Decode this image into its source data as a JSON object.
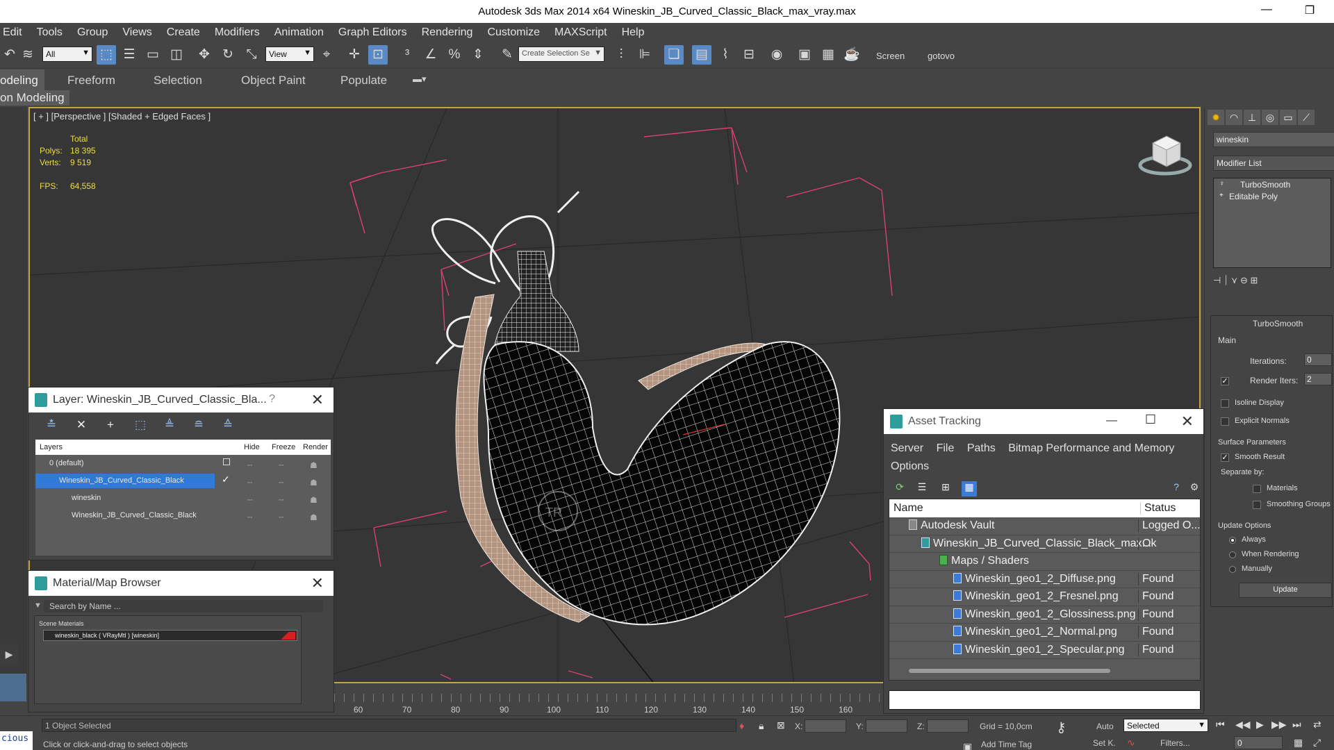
{
  "window": {
    "title": "Autodesk 3ds Max  2014 x64      Wineskin_JB_Curved_Classic_Black_max_vray.max",
    "minimize": "—",
    "restore": "❐"
  },
  "menu": [
    "Edit",
    "Tools",
    "Group",
    "Views",
    "Create",
    "Modifiers",
    "Animation",
    "Graph Editors",
    "Rendering",
    "Customize",
    "MAXScript",
    "Help"
  ],
  "toolbar": {
    "filter_value": "All",
    "refcoord_value": "View",
    "named_selection_placeholder": "Create Selection Se",
    "screen_label": "Screen",
    "gotovo_label": "gotovo"
  },
  "ribbon": {
    "tabs": [
      "odeling",
      "Freeform",
      "Selection",
      "Object Paint",
      "Populate"
    ],
    "sub_label": "on Modeling"
  },
  "viewport": {
    "label": "[ + ] [Perspective ] [Shaded + Edged Faces ]",
    "stats": {
      "total_label": "Total",
      "polys_label": "Polys:",
      "polys_value": "18 395",
      "verts_label": "Verts:",
      "verts_value": "9 519",
      "fps_label": "FPS:",
      "fps_value": "64,558"
    }
  },
  "layer_panel": {
    "title": "Layer: Wineskin_JB_Curved_Classic_Bla...",
    "help": "?",
    "close": "✕",
    "columns": [
      "Layers",
      "Hide",
      "Freeze",
      "Render"
    ],
    "rows": [
      {
        "name": "0 (default)",
        "indent": 0,
        "selected": false
      },
      {
        "name": "Wineskin_JB_Curved_Classic_Black",
        "indent": 0,
        "selected": true
      },
      {
        "name": "wineskin",
        "indent": 1,
        "selected": false
      },
      {
        "name": "Wineskin_JB_Curved_Classic_Black",
        "indent": 1,
        "selected": false
      }
    ]
  },
  "material_browser": {
    "title": "Material/Map Browser",
    "close": "✕",
    "search_placeholder": "Search by Name ...",
    "group": "Scene Materials",
    "item": "wineskin_black  ( VRayMtl ) [wineskin]"
  },
  "asset_tracking": {
    "title": "Asset Tracking",
    "minimize": "—",
    "maximize": "☐",
    "close": "✕",
    "menu_row1": [
      "Server",
      "File",
      "Paths",
      "Bitmap Performance and Memory"
    ],
    "menu_row2": [
      "Options"
    ],
    "columns": [
      "Name",
      "Status"
    ],
    "rows": [
      {
        "name": "Autodesk Vault",
        "status": "Logged O...",
        "indent": 1,
        "icon": "vault"
      },
      {
        "name": "Wineskin_JB_Curved_Classic_Black_max...",
        "status": "Ok",
        "indent": 2,
        "icon": "max"
      },
      {
        "name": "Maps / Shaders",
        "status": "",
        "indent": 3,
        "icon": "maps"
      },
      {
        "name": "Wineskin_geo1_2_Diffuse.png",
        "status": "Found",
        "indent": 4,
        "icon": "file"
      },
      {
        "name": "Wineskin_geo1_2_Fresnel.png",
        "status": "Found",
        "indent": 4,
        "icon": "file"
      },
      {
        "name": "Wineskin_geo1_2_Glossiness.png",
        "status": "Found",
        "indent": 4,
        "icon": "file"
      },
      {
        "name": "Wineskin_geo1_2_Normal.png",
        "status": "Found",
        "indent": 4,
        "icon": "file"
      },
      {
        "name": "Wineskin_geo1_2_Specular.png",
        "status": "Found",
        "indent": 4,
        "icon": "file"
      }
    ]
  },
  "command_panel": {
    "object_name": "wineskin",
    "modifier_list": "Modifier List",
    "stack": [
      "TurboSmooth",
      "Editable Poly"
    ],
    "rollout_title": "TurboSmooth",
    "main_label": "Main",
    "iterations_label": "Iterations:",
    "iterations_value": "0",
    "render_iters_label": "Render Iters:",
    "render_iters_value": "2",
    "isoline_label": "Isoline Display",
    "explicit_normals_label": "Explicit Normals",
    "surface_params_label": "Surface Parameters",
    "smooth_result_label": "Smooth Result",
    "separate_by_label": "Separate by:",
    "materials_label": "Materials",
    "smoothing_groups_label": "Smoothing Groups",
    "update_options_label": "Update Options",
    "always_label": "Always",
    "when_rendering_label": "When Rendering",
    "manually_label": "Manually",
    "update_button": "Update"
  },
  "timeline": {
    "ticks": [
      "60",
      "70",
      "80",
      "90",
      "100",
      "110",
      "120",
      "130",
      "140",
      "150",
      "160"
    ]
  },
  "statusbar": {
    "selection_info": "1 Object Selected",
    "prompt": "Click or click-and-drag to select objects",
    "x_label": "X:",
    "y_label": "Y:",
    "z_label": "Z:",
    "grid": "Grid = 10,0cm",
    "auto_label": "Auto",
    "setk_label": "Set K.",
    "key_filter_value": "Selected",
    "filters_label": "Filters...",
    "add_time_tag": "Add Time Tag",
    "frame_value": "0",
    "script_label": "cious"
  },
  "colors": {
    "viewport_border": "#c9a540",
    "selection_blue": "#2f7ad6",
    "stats_yellow": "#eddc4a",
    "bounding_box_pink": "#d8426e"
  }
}
